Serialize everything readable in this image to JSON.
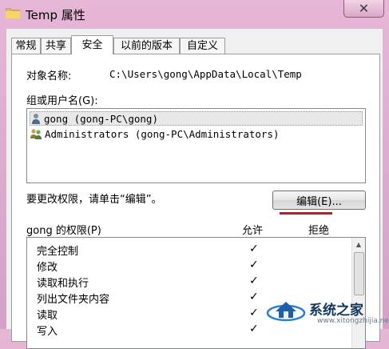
{
  "window": {
    "title": "Temp 属性",
    "close_icon": "close-icon",
    "folder_icon": "folder-icon"
  },
  "tabs": [
    {
      "label": "常规",
      "active": false
    },
    {
      "label": "共享",
      "active": false
    },
    {
      "label": "安全",
      "active": true
    },
    {
      "label": "以前的版本",
      "active": false
    },
    {
      "label": "自定义",
      "active": false
    }
  ],
  "security": {
    "object_name_label": "对象名称:",
    "object_name_value": "C:\\Users\\gong\\AppData\\Local\\Temp",
    "group_label": "组或用户名(G):",
    "users": [
      {
        "name": "gong (gong-PC\\gong)",
        "icon": "user-icon",
        "selected": true
      },
      {
        "name": "Administrators (gong-PC\\Administrators)",
        "icon": "users-group-icon",
        "selected": false
      }
    ],
    "change_hint": "要更改权限，请单击“编辑”。",
    "edit_button": "编辑(E)...",
    "perm_title": "gong 的权限(P)",
    "allow_label": "允许",
    "deny_label": "拒绝",
    "permissions": [
      {
        "name": "完全控制",
        "allow": true
      },
      {
        "name": "修改",
        "allow": true
      },
      {
        "name": "读取和执行",
        "allow": true
      },
      {
        "name": "列出文件夹内容",
        "allow": true
      },
      {
        "name": "读取",
        "allow": true
      },
      {
        "name": "写入",
        "allow": true
      }
    ],
    "check_glyph": "✓"
  },
  "watermark": {
    "text": "系统之家",
    "url": "www.xitongzhijia.net"
  },
  "colors": {
    "frame": "#dba9cc",
    "accent_underline": "#d01222"
  }
}
